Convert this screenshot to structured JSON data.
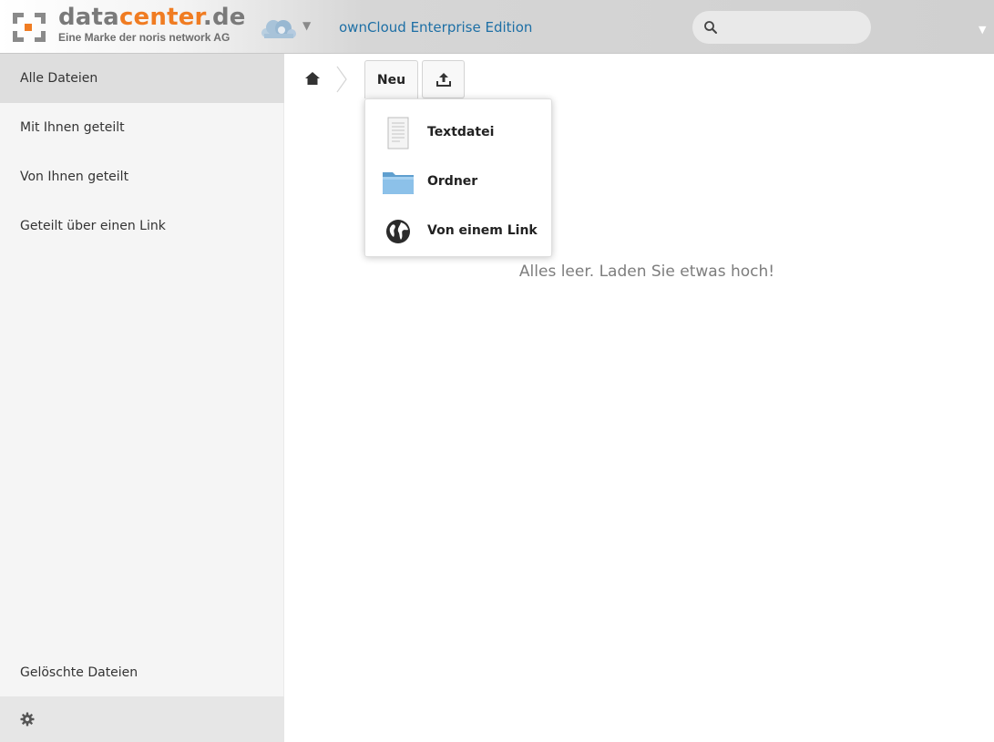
{
  "header": {
    "brand_part1": "data",
    "brand_part2": "center",
    "brand_part3": ".de",
    "tagline": "Eine Marke der noris network AG",
    "app_title": "ownCloud Enterprise Edition",
    "search_placeholder": "",
    "colors": {
      "brand_orange": "#f07c22",
      "brand_gray": "#7a7a7a",
      "link_blue": "#1d6fa5"
    }
  },
  "sidebar": {
    "items": [
      {
        "label": "Alle Dateien",
        "active": true
      },
      {
        "label": "Mit Ihnen geteilt",
        "active": false
      },
      {
        "label": "Von Ihnen geteilt",
        "active": false
      },
      {
        "label": "Geteilt über einen Link",
        "active": false
      }
    ],
    "deleted_files_label": "Gelöschte Dateien",
    "settings_icon": "gear-icon"
  },
  "toolbar": {
    "home_icon": "home-icon",
    "new_label": "Neu",
    "upload_icon": "upload-icon"
  },
  "new_menu": {
    "items": [
      {
        "label": "Textdatei",
        "icon": "text-file-icon"
      },
      {
        "label": "Ordner",
        "icon": "folder-icon"
      },
      {
        "label": "Von einem Link",
        "icon": "globe-icon"
      }
    ]
  },
  "main": {
    "empty_message": "Alles leer. Laden Sie etwas hoch!"
  }
}
